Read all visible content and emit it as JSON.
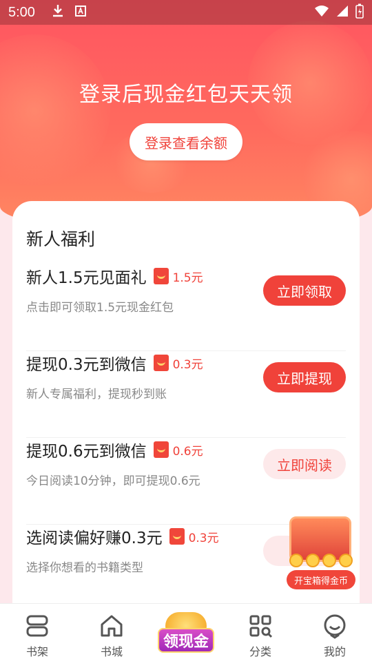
{
  "status_bar": {
    "time": "5:00"
  },
  "hero": {
    "title": "登录后现金红包天天领",
    "login_button": "登录查看余额"
  },
  "card": {
    "title": "新人福利",
    "tasks": [
      {
        "title": "新人1.5元见面礼",
        "reward": "1.5元",
        "desc": "点击即可领取1.5元现金红包",
        "button": "立即领取",
        "button_style": "solid"
      },
      {
        "title": "提现0.3元到微信",
        "reward": "0.3元",
        "desc": "新人专属福利，提现秒到账",
        "button": "立即提现",
        "button_style": "solid"
      },
      {
        "title": "提现0.6元到微信",
        "reward": "0.6元",
        "desc": "今日阅读10分钟，即可提现0.6元",
        "button": "立即阅读",
        "button_style": "soft"
      },
      {
        "title": "选阅读偏好赚0.3元",
        "reward": "0.3元",
        "desc": "选择你想看的书籍类型",
        "button": "立",
        "button_style": "soft"
      }
    ]
  },
  "treasure_chest": {
    "label": "开宝箱得金币"
  },
  "tabbar": {
    "items": [
      {
        "label": "书架",
        "icon": "bookshelf-icon"
      },
      {
        "label": "书城",
        "icon": "home-icon"
      },
      {
        "label": "领现金",
        "icon": "money-coins-icon"
      },
      {
        "label": "分类",
        "icon": "category-grid-icon"
      },
      {
        "label": "我的",
        "icon": "profile-icon"
      }
    ]
  },
  "colors": {
    "accent": "#f0423a",
    "hero_top": "#ff5561",
    "hero_bottom": "#ff8a62",
    "soft_button": "#fde9ea"
  }
}
